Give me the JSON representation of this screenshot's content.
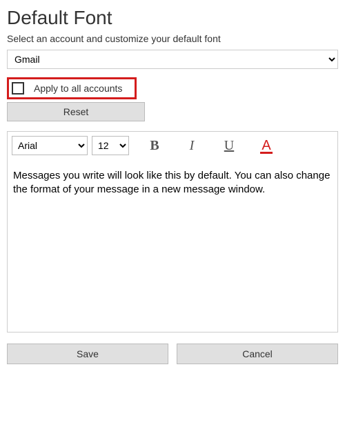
{
  "header": {
    "title": "Default Font",
    "subtitle": "Select an account and customize your default font"
  },
  "account": {
    "selected": "Gmail"
  },
  "apply_all": {
    "label": "Apply to all accounts",
    "checked": false
  },
  "reset_label": "Reset",
  "toolbar": {
    "font_family": "Arial",
    "font_size": "12",
    "bold": "B",
    "italic": "I",
    "underline": "U",
    "color": "A"
  },
  "editor": {
    "sample_text": "Messages you write will look like this by default. You can also change the format of your message in a new message window."
  },
  "buttons": {
    "save": "Save",
    "cancel": "Cancel"
  }
}
